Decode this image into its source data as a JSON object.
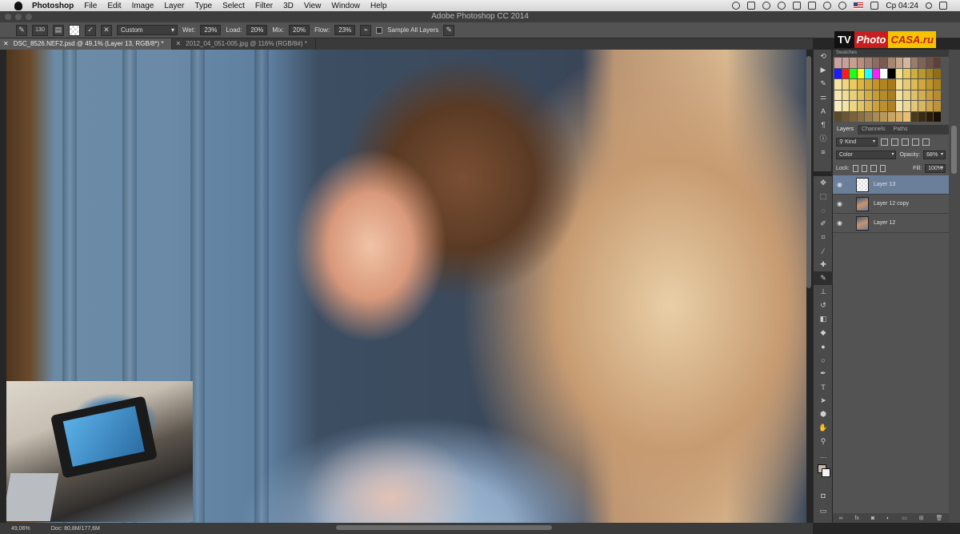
{
  "menubar": {
    "items": [
      "Photoshop",
      "File",
      "Edit",
      "Image",
      "Layer",
      "Type",
      "Select",
      "Filter",
      "3D",
      "View",
      "Window",
      "Help"
    ],
    "clock": "Ср 04:24"
  },
  "window": {
    "title": "Adobe Photoshop CC 2014"
  },
  "options": {
    "brush_size": "130",
    "preset": "Custom",
    "wet_label": "Wet:",
    "wet": "23%",
    "load_label": "Load:",
    "load": "20%",
    "mix_label": "Mix:",
    "mix": "20%",
    "flow_label": "Flow:",
    "flow": "23%",
    "sample_all_layers": "Sample All Layers"
  },
  "doc_tabs": [
    {
      "label": "DSC_8526.NEF2.psd @ 49,1% (Layer 13, RGB/8*) *",
      "active": true
    },
    {
      "label": "2012_04_051-005.jpg @ 116% (RGB/8#) *",
      "active": false
    }
  ],
  "logo": {
    "tv": "TV",
    "photo": "Photo",
    "casa": "CASA.ru"
  },
  "swatches": {
    "title": "Swatches",
    "colors": [
      "#c9a1a1",
      "#c7a09a",
      "#c4a08f",
      "#b98f80",
      "#a57e73",
      "#8e6b60",
      "#7a5a51",
      "#a6876f",
      "#c6a38b",
      "#d4b59e",
      "#9a7c6c",
      "#7d6457",
      "#6b5147",
      "#5a4239",
      "#1b1bff",
      "#ff1b1b",
      "#1bff1b",
      "#ffff1b",
      "#1bffff",
      "#ff1bff",
      "#ffffff",
      "#000000",
      "#f4e08a",
      "#e6c95e",
      "#d1ae3c",
      "#bb962a",
      "#a7831f",
      "#8f6e16",
      "#f3e4a3",
      "#eed681",
      "#e9ca60",
      "#dcb640",
      "#cfa631",
      "#c09426",
      "#b2851f",
      "#a77a1a",
      "#f1dc92",
      "#e7cb72",
      "#dcba54",
      "#cfa73d",
      "#bf942c",
      "#ad8320",
      "#f6e7b1",
      "#f0dd94",
      "#e8d07a",
      "#dfc05e",
      "#d2ad43",
      "#c49c33",
      "#b68c27",
      "#a97e1f",
      "#f2e0a0",
      "#e9d283",
      "#dfc068",
      "#d3ad4f",
      "#c69c3c",
      "#b88c2d",
      "#f8ecbf",
      "#f3e2a2",
      "#ecd686",
      "#e2c56a",
      "#d7b351",
      "#caa13d",
      "#bb902f",
      "#ae8325",
      "#f4e5ae",
      "#ecd894",
      "#e3c779",
      "#d7b660",
      "#cba44b",
      "#bc933a",
      "#5a4a2a",
      "#6a5632",
      "#7a633a",
      "#8a7042",
      "#9a7d4a",
      "#aa8a52",
      "#ba975a",
      "#caa462",
      "#dab16a",
      "#eabe72",
      "#4a3a1a",
      "#3a2a10",
      "#2a1c08",
      "#1a1004"
    ]
  },
  "layers_panel": {
    "tabs": [
      "Layers",
      "Channels",
      "Paths"
    ],
    "filter": "Kind",
    "blend_mode": "Color",
    "opacity_label": "Opacity:",
    "opacity": "68%",
    "lock_label": "Lock:",
    "fill_label": "Fill:",
    "fill": "100%",
    "layers": [
      {
        "name": "Layer 13",
        "active": true,
        "thumb": "checker"
      },
      {
        "name": "Layer 12 copy",
        "active": false,
        "thumb": "photo"
      },
      {
        "name": "Layer 12",
        "active": false,
        "thumb": "photo"
      }
    ],
    "footer_icons": [
      "link-icon",
      "fx-icon",
      "mask-icon",
      "adjustment-icon",
      "folder-icon",
      "new-layer-icon",
      "trash-icon"
    ]
  },
  "status": {
    "zoom": "49,06%",
    "doc": "Doc: 80,8M/177,6M"
  }
}
